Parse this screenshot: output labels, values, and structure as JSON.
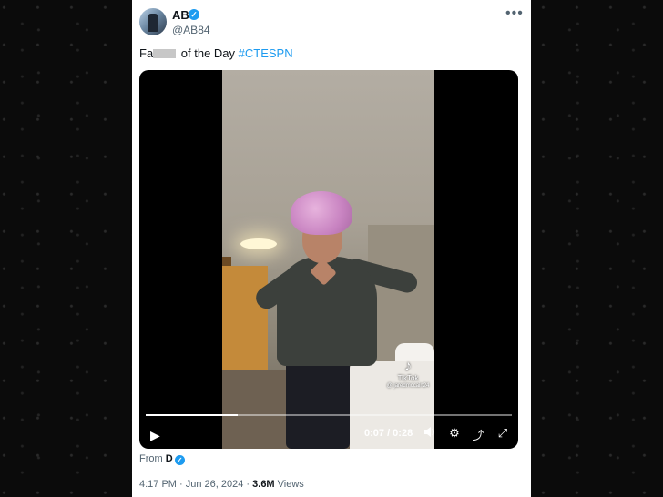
{
  "author": {
    "name": "AB",
    "handle": "@AB84",
    "verified_icon": "check"
  },
  "more_icon": "•••",
  "tweet": {
    "prefix": "Fa",
    "suffix": " of the Day ",
    "hashtag": "#CTESPN"
  },
  "video": {
    "watermark_logo": "♪",
    "watermark_brand": "TikTok",
    "watermark_user": "@ jaredmccain24",
    "time": "0:07 / 0:28",
    "progress": 0.25,
    "icons": {
      "play": "▶",
      "volume": "🔊",
      "settings": "⚙",
      "popout": "⤴",
      "fullscreen": "⤢"
    }
  },
  "from": {
    "label": "From",
    "name": "D"
  },
  "meta": {
    "time": "4:17 PM · Jun 26, 2024 · ",
    "views_count": "3.6M",
    "views_label": " Views"
  },
  "colors": {
    "accent": "#1d9bf0",
    "text": "#0f1419",
    "muted": "#536471"
  }
}
